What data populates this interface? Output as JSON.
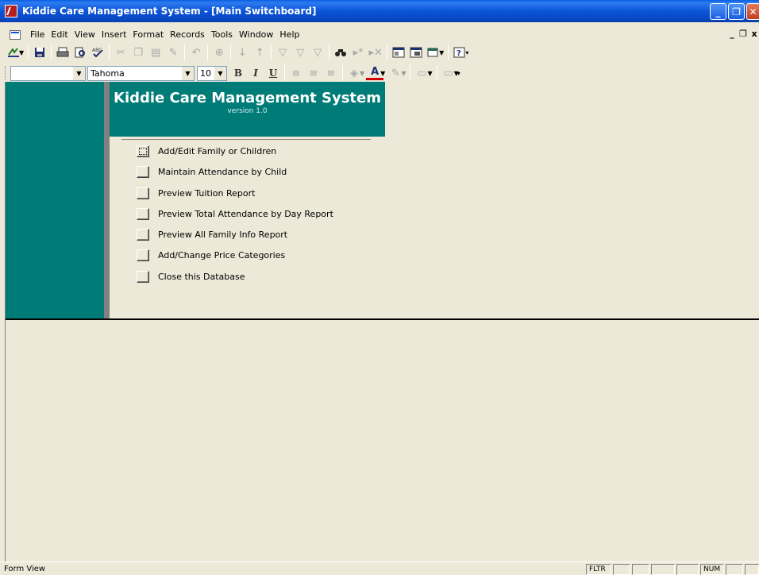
{
  "window": {
    "title": "Kiddie Care Management System - [Main Switchboard]",
    "min_glyph": "_",
    "restore_glyph": "❐",
    "close_glyph": "✕"
  },
  "menu": {
    "items": [
      "File",
      "Edit",
      "View",
      "Insert",
      "Format",
      "Records",
      "Tools",
      "Window",
      "Help"
    ],
    "mdi_min": "_",
    "mdi_restore": "❐",
    "mdi_close": "x"
  },
  "toolbar": {
    "font_name": "Tahoma",
    "font_size": "10",
    "object_combo": "",
    "bold_glyph": "B",
    "italic_glyph": "I",
    "underline_glyph": "U",
    "font_color_glyph": "A"
  },
  "switchboard": {
    "title": "Kiddie Care Management System",
    "version": "version 1.0",
    "items": [
      {
        "label": "Add/Edit Family or Children"
      },
      {
        "label": "Maintain Attendance by Child"
      },
      {
        "label": "Preview Tuition Report"
      },
      {
        "label": "Preview Total Attendance by Day Report"
      },
      {
        "label": "Preview All Family Info Report"
      },
      {
        "label": "Add/Change Price Categories"
      },
      {
        "label": "Close this Database"
      }
    ]
  },
  "status": {
    "text": "Form View",
    "panels": [
      "FLTR",
      "",
      "",
      "",
      "",
      "NUM",
      "",
      ""
    ]
  },
  "colors": {
    "teal": "#007c78",
    "titlebar_blue": "#0b54d8",
    "background": "#ece9d8"
  }
}
